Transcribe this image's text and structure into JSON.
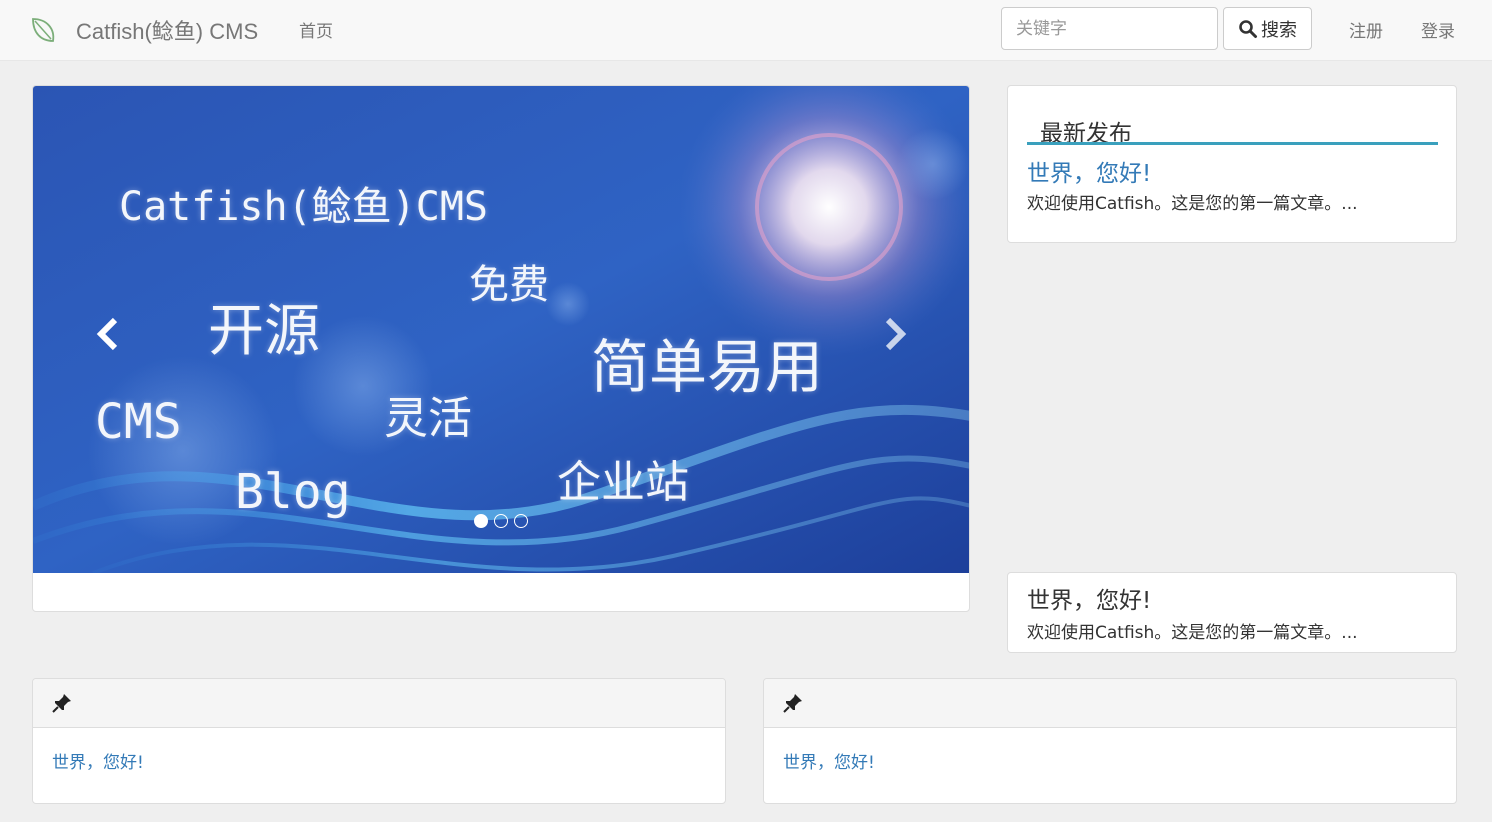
{
  "header": {
    "brand": "Catfish(鲶鱼) CMS",
    "nav_home": "首页",
    "search": {
      "placeholder": "关键字",
      "button_label": "搜索"
    },
    "register": "注册",
    "login": "登录"
  },
  "carousel": {
    "banner_words": {
      "title": "Catfish(鲶鱼)CMS",
      "free": "免费",
      "open_source": "开源",
      "easy": "简单易用",
      "cms": "CMS",
      "flexible": "灵活",
      "blog": "Blog",
      "enterprise": "企业站"
    },
    "slides": 3,
    "active_slide": 1
  },
  "latest": {
    "heading": "最新发布",
    "items": [
      {
        "title": "世界，您好!",
        "excerpt": "欢迎使用Catfish。这是您的第一篇文章。..."
      }
    ]
  },
  "featured": {
    "title": "世界，您好!",
    "excerpt": "欢迎使用Catfish。这是您的第一篇文章。..."
  },
  "pinned": [
    {
      "icon": "pushpin-icon",
      "link": "世界，您好!"
    },
    {
      "icon": "pushpin-icon",
      "link": "世界，您好!"
    }
  ],
  "colors": {
    "link": "#337ab7",
    "accent": "#3aa0bd",
    "navbar_bg": "#f8f8f8",
    "page_bg": "#efefef"
  }
}
